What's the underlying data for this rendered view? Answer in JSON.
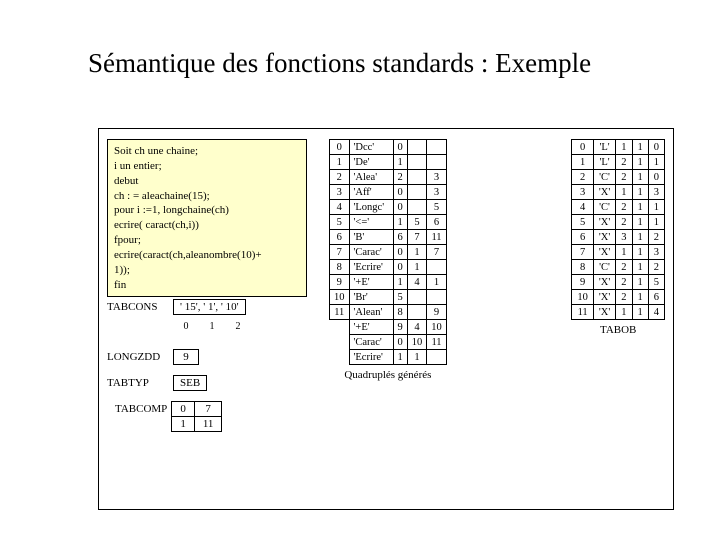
{
  "title": "Sémantique des fonctions standards : Exemple",
  "code": [
    "Soit  ch une chaine;",
    "  i un entier;",
    "debut",
    "  ch : = aleachaine(15);",
    "  pour i :=1, longchaine(ch)",
    "    ecrire( caract(ch,i))",
    "  fpour;",
    "ecrire(caract(ch,aleanombre(10)+",
    "1));",
    "fin"
  ],
  "tabcons": {
    "label": "TABCONS",
    "values": [
      "' 15', ' 1', ' 10'"
    ],
    "idx": [
      "0",
      "1",
      "2"
    ]
  },
  "longzdd": {
    "label": "LONGZDD",
    "value": "9"
  },
  "tabtyp": {
    "label": "TABTYP",
    "value": "SEB"
  },
  "tabcomp": {
    "label": "TABCOMP",
    "rows": [
      [
        "0",
        "7"
      ],
      [
        "1",
        "11"
      ]
    ]
  },
  "middle": {
    "rows": [
      [
        "0",
        "'Dcc'",
        "0",
        "",
        "",
        ""
      ],
      [
        "1",
        "'De'",
        "1",
        "",
        "",
        ""
      ],
      [
        "2",
        "'Alea'",
        "2",
        "",
        "3",
        ""
      ],
      [
        "3",
        "'Aff'",
        "0",
        "",
        "3",
        ""
      ],
      [
        "4",
        "'Longc'",
        "0",
        "",
        "5",
        ""
      ],
      [
        "5",
        "'<='",
        "1",
        "5",
        "6",
        ""
      ],
      [
        "6",
        "'B'",
        "6",
        "7",
        "11",
        ""
      ],
      [
        "7",
        "'Carac'",
        "0",
        "1",
        "7",
        ""
      ],
      [
        "8",
        "'Ecrire'",
        "0",
        "1",
        "",
        ""
      ],
      [
        "9",
        "'+E'",
        "1",
        "4",
        "1",
        ""
      ],
      [
        "10",
        "'Br'",
        "5",
        "",
        "",
        ""
      ],
      [
        "11",
        "'Alean'",
        "8",
        "",
        "9",
        ""
      ],
      [
        "",
        "'+E'",
        "9",
        "4",
        "10",
        ""
      ],
      [
        "",
        "'Carac'",
        "0",
        "10",
        "11",
        ""
      ],
      [
        "",
        "'Ecrire'",
        "1",
        "1",
        "",
        ""
      ]
    ],
    "caption": "Quadruplés générés"
  },
  "right": {
    "rows": [
      [
        "0",
        "'L'",
        "1",
        "1",
        "0"
      ],
      [
        "1",
        "'L'",
        "2",
        "1",
        "1"
      ],
      [
        "2",
        "'C'",
        "2",
        "1",
        "0"
      ],
      [
        "3",
        "'X'",
        "1",
        "1",
        "3"
      ],
      [
        "4",
        "'C'",
        "2",
        "1",
        "1"
      ],
      [
        "5",
        "'X'",
        "2",
        "1",
        "1"
      ],
      [
        "6",
        "'X'",
        "3",
        "1",
        "2"
      ],
      [
        "7",
        "'X'",
        "1",
        "1",
        "3"
      ],
      [
        "8",
        "'C'",
        "2",
        "1",
        "2"
      ],
      [
        "9",
        "'X'",
        "2",
        "1",
        "5"
      ],
      [
        "10",
        "'X'",
        "2",
        "1",
        "6"
      ],
      [
        "11",
        "'X'",
        "1",
        "1",
        "4"
      ]
    ],
    "caption": "TABOB"
  },
  "chart_data": {
    "type": "table",
    "title": "Sémantique des fonctions standards : Exemple",
    "tables": {
      "TABCONS": {
        "values": [
          "'15'",
          "'1'",
          "'10'"
        ],
        "index": [
          0,
          1,
          2
        ]
      },
      "LONGZDD": 9,
      "TABTYP": "SEB",
      "TABCOMP": [
        [
          0,
          7
        ],
        [
          1,
          11
        ]
      ],
      "Quadruples": [
        {
          "i": 0,
          "op": "Dcc",
          "a": 0
        },
        {
          "i": 1,
          "op": "De",
          "a": 1
        },
        {
          "i": 2,
          "op": "Alea",
          "a": 2,
          "c": 3
        },
        {
          "i": 3,
          "op": "Aff",
          "a": 0,
          "c": 3
        },
        {
          "i": 4,
          "op": "Longc",
          "a": 0,
          "c": 5
        },
        {
          "i": 5,
          "op": "<=",
          "a": 1,
          "b": 5,
          "c": 6
        },
        {
          "i": 6,
          "op": "B",
          "a": 6,
          "b": 7,
          "c": 11
        },
        {
          "i": 7,
          "op": "Carac",
          "a": 0,
          "b": 1,
          "c": 7
        },
        {
          "i": 8,
          "op": "Ecrire",
          "a": 0,
          "b": 1
        },
        {
          "i": 9,
          "op": "+E",
          "a": 1,
          "b": 4,
          "c": 1
        },
        {
          "i": 10,
          "op": "Br",
          "a": 5
        },
        {
          "i": 11,
          "op": "Alean",
          "a": 8,
          "c": 9
        },
        {
          "op": "+E",
          "a": 9,
          "b": 4,
          "c": 10
        },
        {
          "op": "Carac",
          "a": 0,
          "b": 10,
          "c": 11
        },
        {
          "op": "Ecrire",
          "a": 1,
          "b": 1
        }
      ],
      "TABOB": [
        {
          "i": 0,
          "t": "L",
          "a": 1,
          "b": 1,
          "c": 0
        },
        {
          "i": 1,
          "t": "L",
          "a": 2,
          "b": 1,
          "c": 1
        },
        {
          "i": 2,
          "t": "C",
          "a": 2,
          "b": 1,
          "c": 0
        },
        {
          "i": 3,
          "t": "X",
          "a": 1,
          "b": 1,
          "c": 3
        },
        {
          "i": 4,
          "t": "C",
          "a": 2,
          "b": 1,
          "c": 1
        },
        {
          "i": 5,
          "t": "X",
          "a": 2,
          "b": 1,
          "c": 1
        },
        {
          "i": 6,
          "t": "X",
          "a": 3,
          "b": 1,
          "c": 2
        },
        {
          "i": 7,
          "t": "X",
          "a": 1,
          "b": 1,
          "c": 3
        },
        {
          "i": 8,
          "t": "C",
          "a": 2,
          "b": 1,
          "c": 2
        },
        {
          "i": 9,
          "t": "X",
          "a": 2,
          "b": 1,
          "c": 5
        },
        {
          "i": 10,
          "t": "X",
          "a": 2,
          "b": 1,
          "c": 6
        },
        {
          "i": 11,
          "t": "X",
          "a": 1,
          "b": 1,
          "c": 4
        }
      ]
    }
  }
}
